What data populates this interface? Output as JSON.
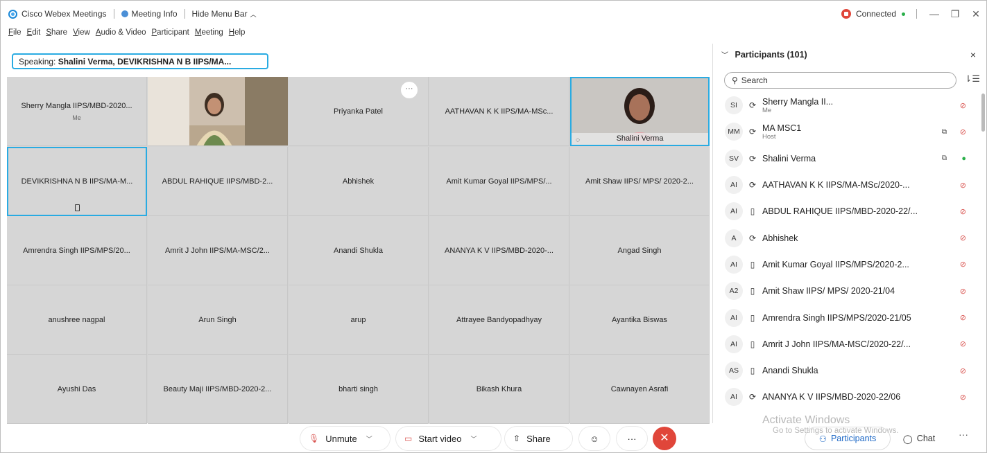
{
  "titlebar": {
    "app_name": "Cisco Webex Meetings",
    "meeting_info": "Meeting Info",
    "hide_menu": "Hide Menu Bar",
    "connection": "Connected",
    "minimize": "—",
    "restore": "❐",
    "close": "✕"
  },
  "menu": [
    "File",
    "Edit",
    "Share",
    "View",
    "Audio & Video",
    "Participant",
    "Meeting",
    "Help"
  ],
  "speaking": {
    "label": "Speaking:",
    "names": "Shalini Verma, DEVIKRISHNA N B IIPS/MA..."
  },
  "grid": {
    "row1": {
      "t1_name": "Sherry Mangla IIPS/MBD-2020...",
      "t1_sub": "Me",
      "t3_name": "Priyanka Patel",
      "t3_more": "···",
      "t4_name": "AATHAVAN K K IIPS/MA-MSc...",
      "t5_name": "Shalini Verma"
    },
    "row2": [
      "DEVIKRISHNA N B IIPS/MA-M...",
      "ABDUL RAHIQUE IIPS/MBD-2...",
      "Abhishek",
      "Amit Kumar Goyal IIPS/MPS/...",
      "Amit Shaw IIPS/ MPS/ 2020-2..."
    ],
    "row3": [
      "Amrendra Singh IIPS/MPS/20...",
      "Amrit J John IIPS/MA-MSC/2...",
      "Anandi Shukla",
      "ANANYA K V IIPS/MBD-2020-...",
      "Angad Singh"
    ],
    "row4": [
      "anushree nagpal",
      "Arun Singh",
      "arup",
      "Attrayee Bandyopadhyay",
      "Ayantika Biswas"
    ],
    "row5": [
      "Ayushi Das",
      "Beauty Maji IIPS/MBD-2020-2...",
      "bharti singh",
      "Bikash Khura",
      "Cawnayen Asrafi"
    ]
  },
  "panel": {
    "title": "Participants (101)",
    "close": "×",
    "search_placeholder": "Search",
    "participants": [
      {
        "initials": "SI",
        "name": "Sherry Mangla II...",
        "sub": "Me",
        "device": "⟳",
        "camera": "",
        "mic": "muted"
      },
      {
        "initials": "MM",
        "name": "MA MSC1",
        "sub": "Host",
        "device": "⟳",
        "camera": "⧉",
        "mic": "muted"
      },
      {
        "initials": "SV",
        "name": "Shalini Verma",
        "sub": "",
        "device": "⟳",
        "camera": "⧉",
        "mic": "on"
      },
      {
        "initials": "AI",
        "name": "AATHAVAN K K IIPS/MA-MSc/2020-...",
        "sub": "",
        "device": "⟳",
        "camera": "",
        "mic": "muted"
      },
      {
        "initials": "AI",
        "name": "ABDUL RAHIQUE IIPS/MBD-2020-22/...",
        "sub": "",
        "device": "▯",
        "camera": "",
        "mic": "muted"
      },
      {
        "initials": "A",
        "name": "Abhishek",
        "sub": "",
        "device": "⟳",
        "camera": "",
        "mic": "muted"
      },
      {
        "initials": "AI",
        "name": "Amit Kumar Goyal IIPS/MPS/2020-2...",
        "sub": "",
        "device": "▯",
        "camera": "",
        "mic": "muted"
      },
      {
        "initials": "A2",
        "name": "Amit Shaw IIPS/ MPS/ 2020-21/04",
        "sub": "",
        "device": "▯",
        "camera": "",
        "mic": "muted"
      },
      {
        "initials": "AI",
        "name": "Amrendra Singh IIPS/MPS/2020-21/05",
        "sub": "",
        "device": "▯",
        "camera": "",
        "mic": "muted"
      },
      {
        "initials": "AI",
        "name": "Amrit J John IIPS/MA-MSC/2020-22/...",
        "sub": "",
        "device": "▯",
        "camera": "",
        "mic": "muted"
      },
      {
        "initials": "AS",
        "name": "Anandi Shukla",
        "sub": "",
        "device": "▯",
        "camera": "",
        "mic": "muted"
      },
      {
        "initials": "AI",
        "name": "ANANYA K V IIPS/MBD-2020-22/06",
        "sub": "",
        "device": "⟳",
        "camera": "",
        "mic": "muted"
      }
    ]
  },
  "watermark": {
    "line1": "Activate Windows",
    "line2": "Go to Settings to activate Windows."
  },
  "toolbar": {
    "unmute": "Unmute",
    "start_video": "Start video",
    "share": "Share",
    "reactions": "☺",
    "more": "···",
    "leave": "✕",
    "participants": "Participants",
    "chat": "Chat",
    "more_right": "···"
  }
}
